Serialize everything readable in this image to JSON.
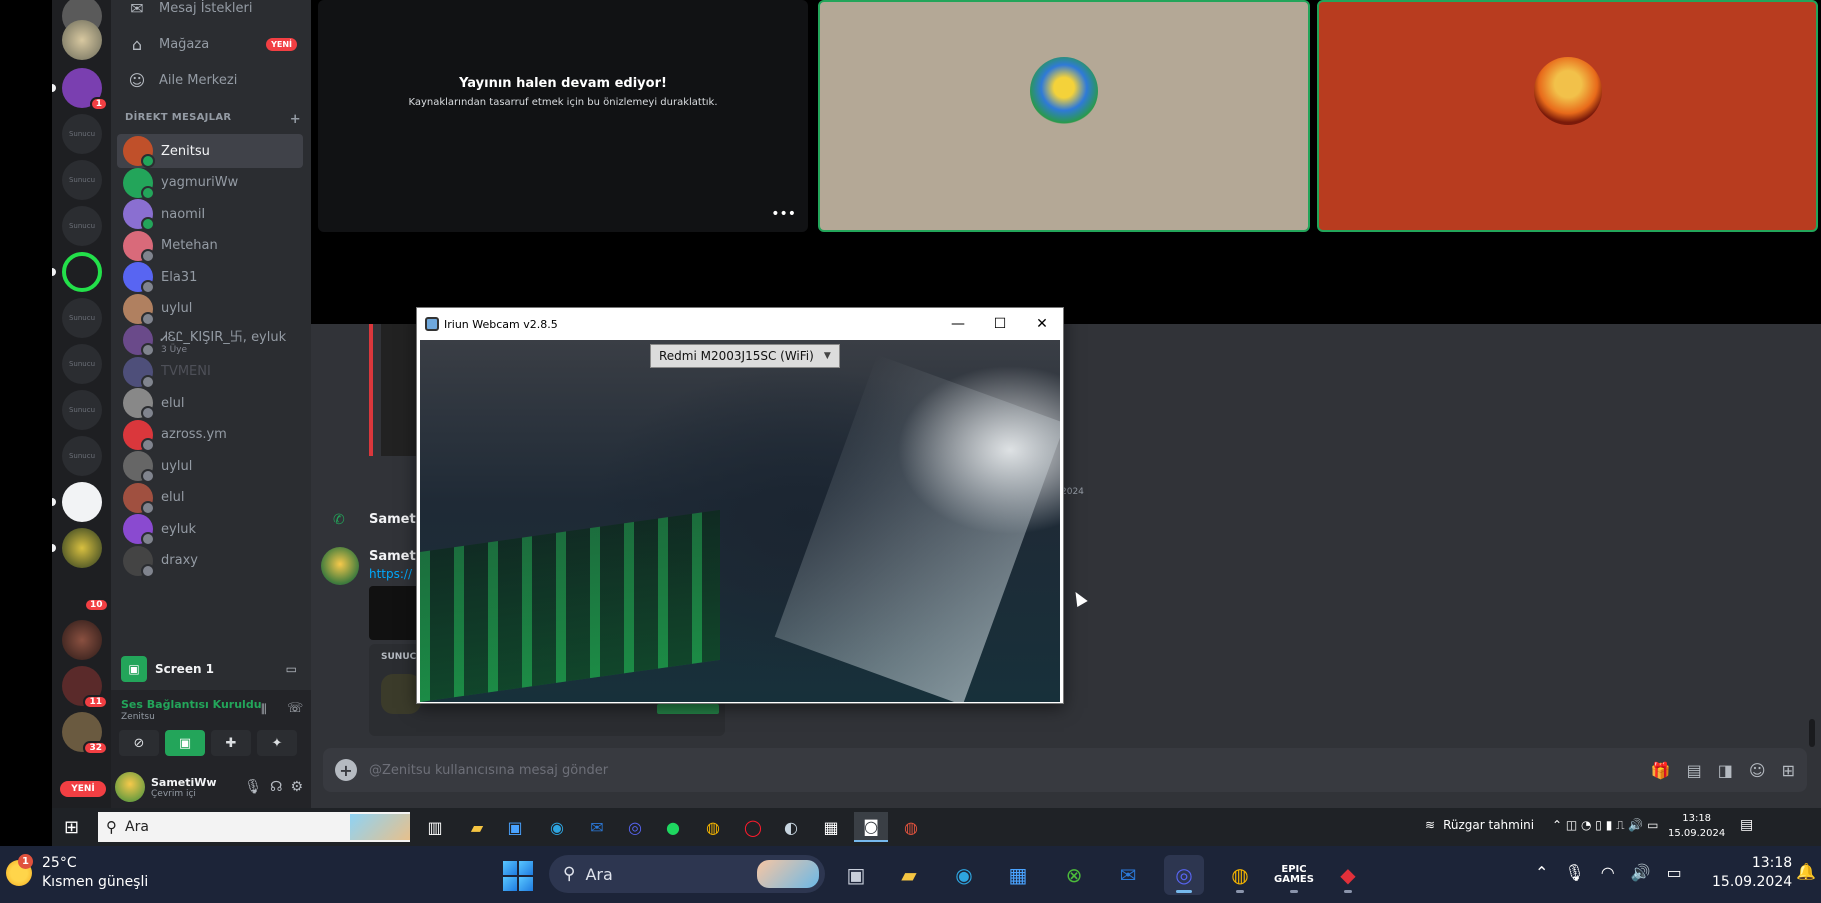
{
  "discord": {
    "nav": {
      "message_requests": "Mesaj İstekleri",
      "shop": "Mağaza",
      "shop_badge": "YENİ",
      "family_center": "Aile Merkezi"
    },
    "dm_header": "DİREKT MESAJLAR",
    "dm_add": "+",
    "dms": [
      {
        "name": "Zenitsu",
        "active": true,
        "color": "#c0502a"
      },
      {
        "name": "yagmuriWw",
        "color": "#23a55a"
      },
      {
        "name": "naomiI",
        "color": "#8a6fd1"
      },
      {
        "name": "Metehan",
        "color": "#d96a7a"
      },
      {
        "name": "Ela31",
        "color": "#5865f2"
      },
      {
        "name": "uylul",
        "color": "#b08060"
      },
      {
        "name": "ᏗᏋᏝ_KIŞIR_卐, eyluk",
        "sub": "3 Üye",
        "color": "#6a4a8a"
      },
      {
        "name": "TVMENI",
        "dim": true,
        "color": "#4e4f7a"
      },
      {
        "name": "elul",
        "color": "#888"
      },
      {
        "name": "azross.ym",
        "color": "#da373c"
      },
      {
        "name": "uylul",
        "color": "#666"
      },
      {
        "name": "elul",
        "color": "#a05040"
      },
      {
        "name": "eyluk",
        "color": "#8a4ad0"
      },
      {
        "name": "draxy",
        "color": "#444"
      }
    ],
    "stream_card": "Screen 1",
    "voice_status": "Ses Bağlantısı Kuruldu",
    "voice_channel": "Zenitsu",
    "user": {
      "name": "SametiWw",
      "status": "Çevrim içi"
    },
    "guild_badges": [
      "1",
      "10",
      "11",
      "32"
    ],
    "guild_placeholder": "Sunucu",
    "guild_new": "YENİ",
    "stream_tile": {
      "title": "Yayının halen devam ediyor!",
      "subtitle": "Kaynaklarından tasarruf etmek için bu önizlemeyi duraklattık.",
      "more": "•••"
    },
    "chat": {
      "date_fragment": "2024",
      "call_author": "SametiV",
      "msg_author": "SametiV",
      "msg_link": "https://",
      "invite_label": "SUNUC"
    },
    "composer_placeholder": "@Zenitsu kullanıcısına mesaj gönder"
  },
  "webcam": {
    "title": "Iriun Webcam v2.8.5",
    "device": "Redmi M2003J15SC (WiFi)"
  },
  "inner_taskbar": {
    "search": "Ara",
    "weather": "Rüzgar tahmini",
    "time": "13:18",
    "date": "15.09.2024"
  },
  "outer_taskbar": {
    "temperature": "25°C",
    "condition": "Kısmen güneşli",
    "weather_badge": "1",
    "search": "Ara",
    "time": "13:18",
    "date": "15.09.2024",
    "epic_label": "EPIC GAMES"
  },
  "colors": {
    "discord_bg": "#313338",
    "sidebar": "#2b2d31",
    "online": "#23a55a",
    "badge": "#f23f43",
    "taskbar": "#1c2438"
  }
}
